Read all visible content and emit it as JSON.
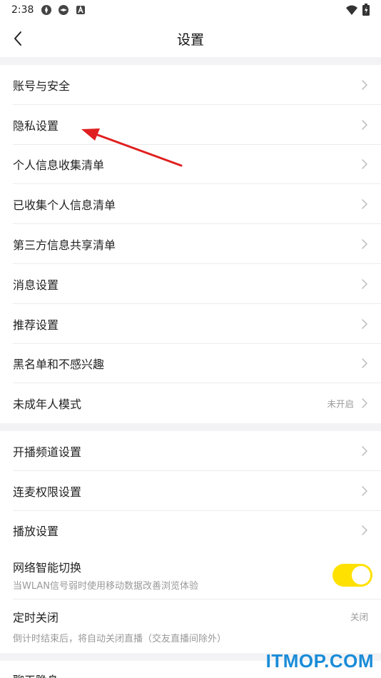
{
  "status_bar": {
    "time": "2:38",
    "icons": [
      "app-icon-1",
      "app-icon-2",
      "a-icon",
      "wifi-icon",
      "battery-icon"
    ]
  },
  "nav": {
    "title": "设置",
    "back_icon": "chevron-left-icon"
  },
  "section1": [
    {
      "label": "账号与安全"
    },
    {
      "label": "隐私设置"
    },
    {
      "label": "个人信息收集清单"
    },
    {
      "label": "已收集个人信息清单"
    },
    {
      "label": "第三方信息共享清单"
    },
    {
      "label": "消息设置"
    },
    {
      "label": "推荐设置"
    },
    {
      "label": "黑名单和不感兴趣"
    },
    {
      "label": "未成年人模式",
      "value": "未开启"
    }
  ],
  "section2": [
    {
      "label": "开播频道设置"
    },
    {
      "label": "连麦权限设置"
    },
    {
      "label": "播放设置"
    }
  ],
  "network_switch": {
    "label": "网络智能切换",
    "sub": "当WLAN信号弱时使用移动数据改善浏览体验",
    "enabled": true,
    "accent": "#ffe100"
  },
  "timer_off": {
    "label": "定时关闭",
    "sub": "倒计时结束后，将自动关闭直播（交友直播间除外）",
    "value": "关闭"
  },
  "section3": [
    {
      "label": "聊天隐身"
    }
  ],
  "watermark": "ITMOP.COM",
  "annotation": {
    "color": "#e02020"
  }
}
